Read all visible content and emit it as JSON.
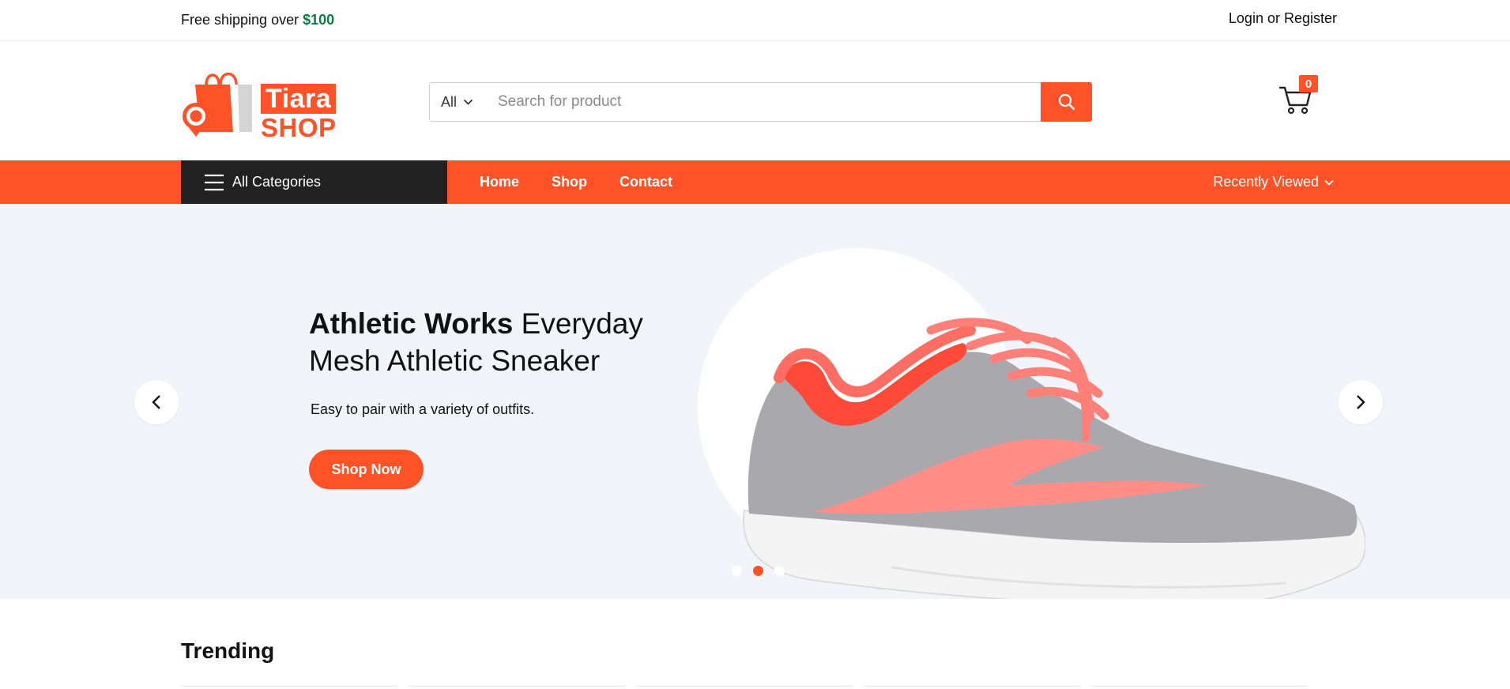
{
  "topbar": {
    "shipping_prefix": "Free shipping over ",
    "shipping_amount": "$100",
    "login": "Login",
    "or": " or ",
    "register": "Register"
  },
  "header": {
    "logo_line1": "Tiara",
    "logo_line2": "SHOP",
    "search": {
      "category": "All",
      "placeholder": "Search for product",
      "button_icon": "search-icon"
    },
    "cart": {
      "icon": "cart-icon",
      "count": "0"
    }
  },
  "nav": {
    "all_categories": "All Categories",
    "links": [
      "Home",
      "Shop",
      "Contact"
    ],
    "recently_viewed": "Recently Viewed"
  },
  "hero": {
    "title_bold": "Athletic Works",
    "title_rest": " Everyday Mesh Athletic Sneaker",
    "subtitle": "Easy to pair with a variety of outfits.",
    "cta": "Shop Now",
    "slides_total": 3,
    "active_slide": 2
  },
  "trending": {
    "title": "Trending"
  },
  "colors": {
    "brand": "#ff5228",
    "dark": "#212121",
    "price_green": "#0d7a43",
    "hero_bg": "#f1f5f9"
  }
}
